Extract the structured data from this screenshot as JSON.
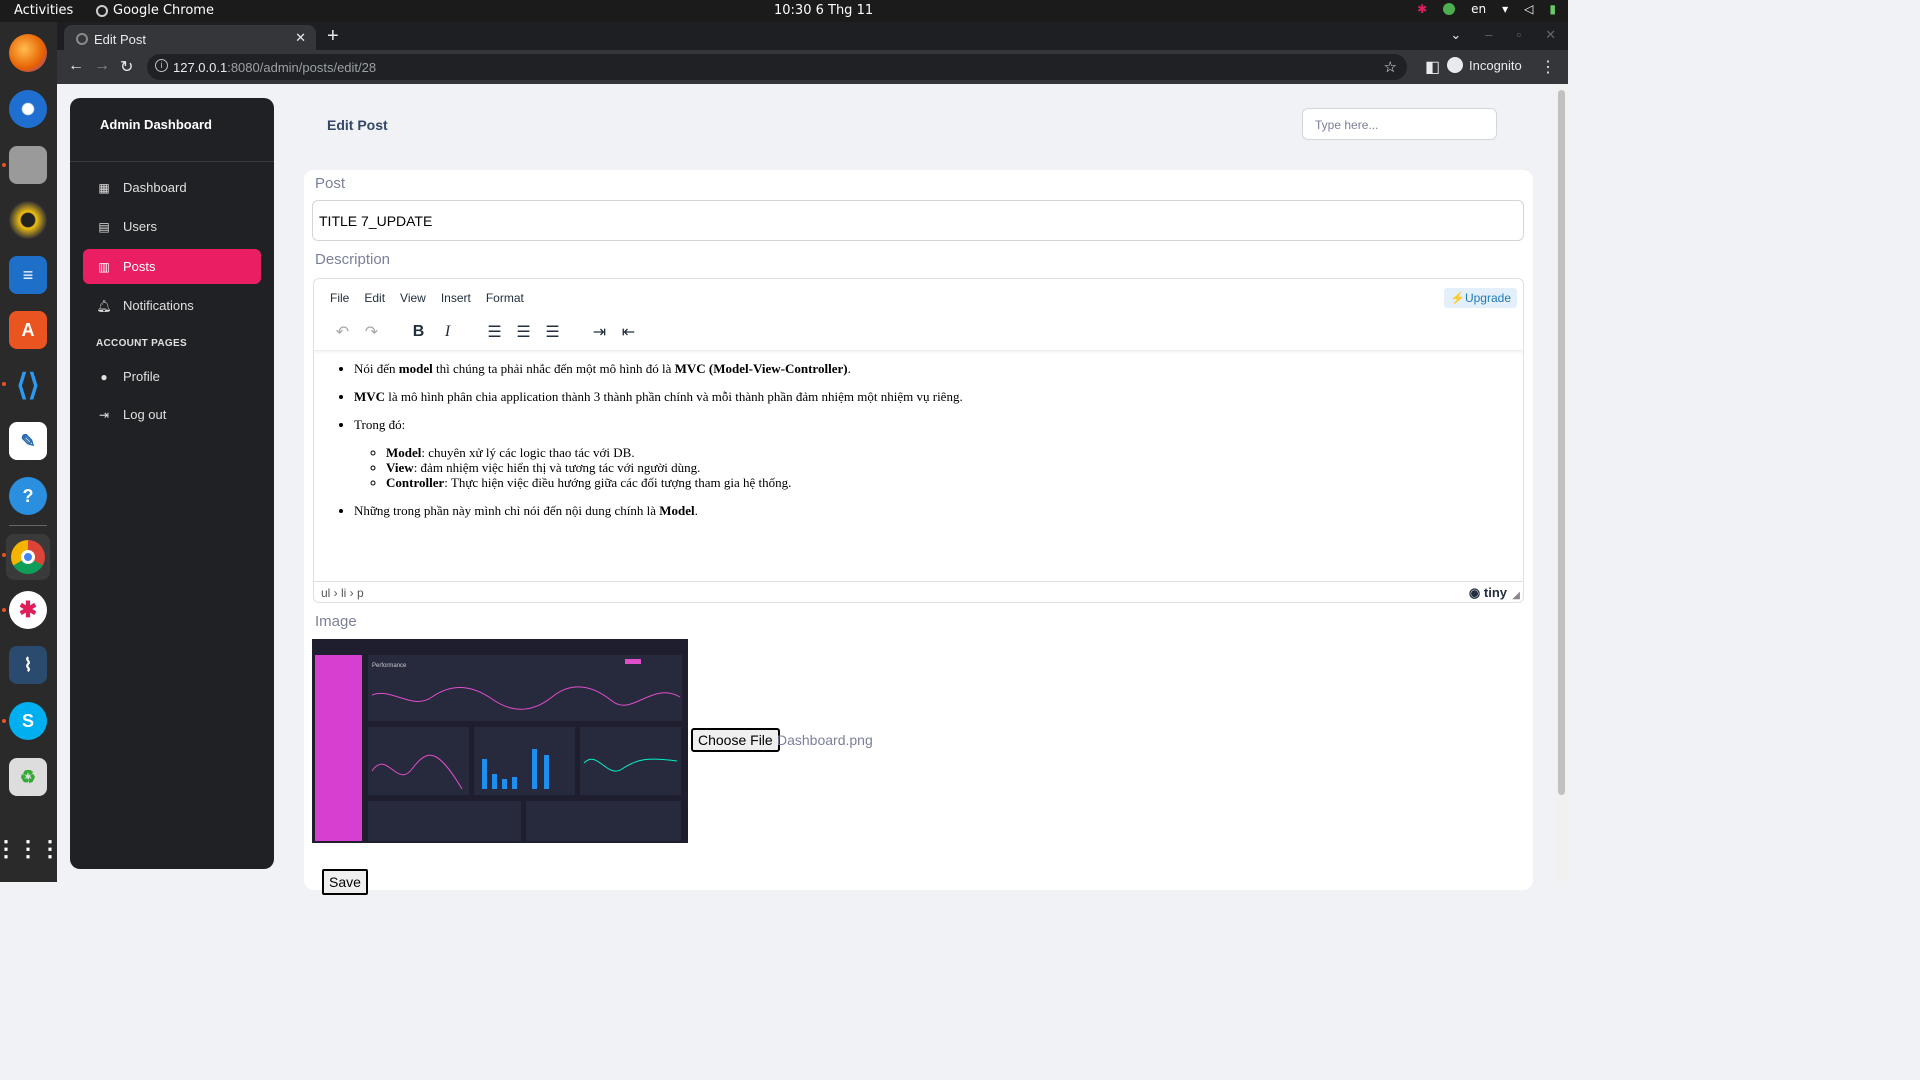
{
  "system": {
    "activities": "Activities",
    "app_name": "Google Chrome",
    "clock": "10:30  6 Thg 11",
    "lang": "en"
  },
  "browser": {
    "tab_title": "Edit Post",
    "url_host": "127.0.0.1",
    "url_path": ":8080/admin/posts/edit/28",
    "profile": "Incognito"
  },
  "sidebar": {
    "brand": "Admin Dashboard",
    "items": [
      {
        "label": "Dashboard",
        "icon": "dashboard-icon"
      },
      {
        "label": "Users",
        "icon": "table-icon"
      },
      {
        "label": "Posts",
        "icon": "receipt-icon",
        "active": true
      },
      {
        "label": "Notifications",
        "icon": "bell-icon"
      }
    ],
    "section_label": "ACCOUNT PAGES",
    "account_items": [
      {
        "label": "Profile",
        "icon": "person-icon"
      },
      {
        "label": "Log out",
        "icon": "logout-icon"
      }
    ]
  },
  "header": {
    "title": "Edit Post",
    "search_placeholder": "Type here..."
  },
  "form": {
    "post_label": "Post",
    "title_value": "TITLE 7_UPDATE",
    "description_label": "Description",
    "image_label": "Image",
    "choose_file": "Choose File",
    "file_name": "Dashboard.png",
    "save": "Save"
  },
  "editor": {
    "menu": [
      "File",
      "Edit",
      "View",
      "Insert",
      "Format"
    ],
    "upgrade": "⚡Upgrade",
    "statusbar_path": "ul › li › p",
    "brand": "tiny",
    "content": {
      "li1_a": "Nói đến ",
      "li1_b": "model",
      "li1_c": " thì chúng ta phải nhắc đến một mô hình đó là ",
      "li1_d": "MVC (Model-View-Controller)",
      "li1_e": ".",
      "li2_a": "MVC",
      "li2_b": " là mô hình phân chia application thành 3 thành phần chính và mỗi thành phần đảm nhiệm một nhiệm vụ riêng.",
      "li3": "Trong đó:",
      "sub1_a": "Model",
      "sub1_b": ": chuyên xử lý các logic thao tác với DB.",
      "sub2_a": "View",
      "sub2_b": ": đảm nhiệm việc hiển thị và tương tác với người dùng.",
      "sub3_a": "Controller",
      "sub3_b": ": Thực hiện việc điều hướng giữa các đối tượng tham gia hệ thống.",
      "li4_a": "Những trong phần này mình chỉ nói đến nội dung chính là ",
      "li4_b": "Model",
      "li4_c": "."
    }
  },
  "preview": {
    "title": "Performance"
  }
}
